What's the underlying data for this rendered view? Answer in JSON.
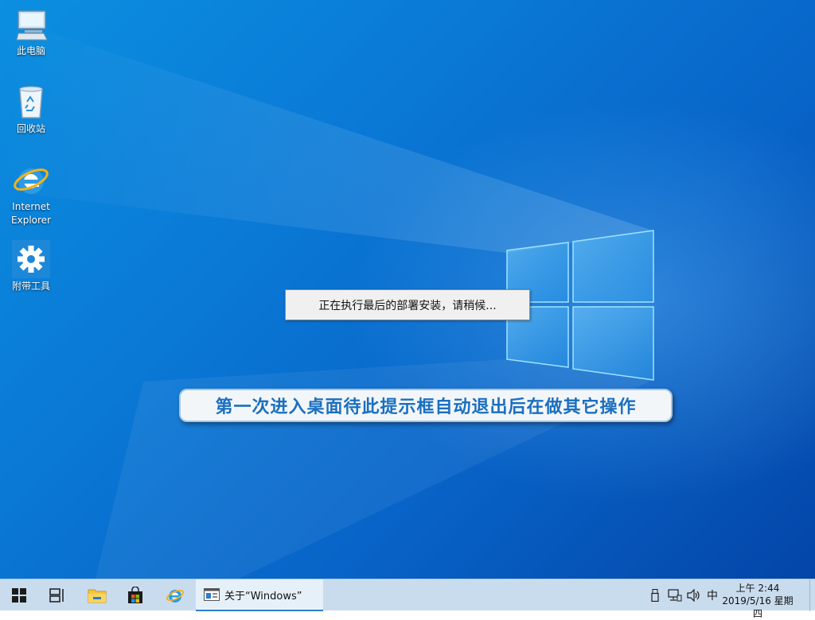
{
  "desktop": {
    "icons": [
      {
        "label": "此电脑",
        "icon": "computer-icon"
      },
      {
        "label": "回收站",
        "icon": "recycle-bin-icon"
      },
      {
        "label": "Internet Explorer",
        "icon": "internet-explorer-icon"
      },
      {
        "label": "附带工具",
        "icon": "gear-icon"
      }
    ],
    "deploy_message": "正在执行最后的部署安装，请稍候...",
    "notice": "第一次进入桌面待此提示框自动退出后在做其它操作"
  },
  "taskbar": {
    "pinned": [
      {
        "name": "start-button",
        "icon": "windows-logo-icon"
      },
      {
        "name": "task-view-button",
        "icon": "task-view-icon"
      },
      {
        "name": "file-explorer-button",
        "icon": "folder-icon"
      },
      {
        "name": "store-button",
        "icon": "store-bag-icon"
      },
      {
        "name": "ie-button",
        "icon": "internet-explorer-icon"
      }
    ],
    "open_window": {
      "label": "关于“Windows”",
      "icon": "window-app-icon"
    },
    "tray": {
      "input_method": "中",
      "icons": [
        "usb-device-icon",
        "network-icon",
        "volume-icon"
      ]
    },
    "clock": {
      "time": "上午 2:44",
      "date": "2019/5/16 星期四"
    }
  },
  "colors": {
    "desktop_blue": "#0a79d6",
    "taskbar": "#c9dcee",
    "notice_text": "#1a6fc0"
  }
}
